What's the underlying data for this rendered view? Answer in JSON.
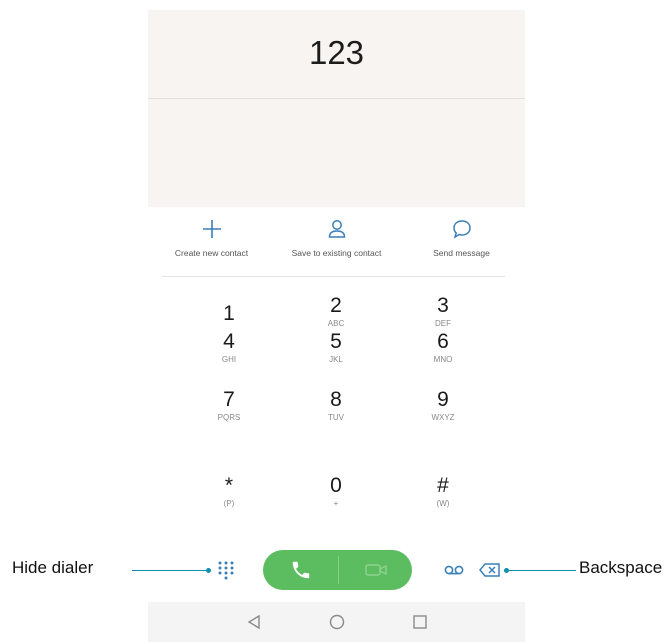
{
  "display": {
    "number": "123"
  },
  "actions": [
    {
      "label": "Create new contact",
      "icon": "plus-icon"
    },
    {
      "label": "Save to existing contact",
      "icon": "person-icon"
    },
    {
      "label": "Send message",
      "icon": "message-bubble-icon"
    }
  ],
  "keypad": [
    {
      "digit": "1",
      "letters": ""
    },
    {
      "digit": "2",
      "letters": "ABC"
    },
    {
      "digit": "3",
      "letters": "DEF"
    },
    {
      "digit": "4",
      "letters": "GHI"
    },
    {
      "digit": "5",
      "letters": "JKL"
    },
    {
      "digit": "6",
      "letters": "MNO"
    },
    {
      "digit": "7",
      "letters": "PQRS"
    },
    {
      "digit": "8",
      "letters": "TUV"
    },
    {
      "digit": "9",
      "letters": "WXYZ"
    },
    {
      "digit": "*",
      "letters": "(P)"
    },
    {
      "digit": "0",
      "letters": "+"
    },
    {
      "digit": "#",
      "letters": "(W)"
    }
  ],
  "bottom_bar": {
    "hide_dialer_icon": "dialpad-grid-icon",
    "call_icon": "phone-icon",
    "video_call_icon": "video-camera-icon",
    "voicemail_icon": "voicemail-icon",
    "backspace_icon": "backspace-icon"
  },
  "callouts": {
    "hide_dialer": "Hide dialer",
    "backspace": "Backspace"
  },
  "navigation": [
    "back-icon",
    "home-icon",
    "recents-icon"
  ],
  "colors": {
    "accent": "#3a7fb8",
    "call_green": "#5bbd60",
    "leader": "#0e8fb0",
    "display_bg": "#f7f4f1"
  }
}
